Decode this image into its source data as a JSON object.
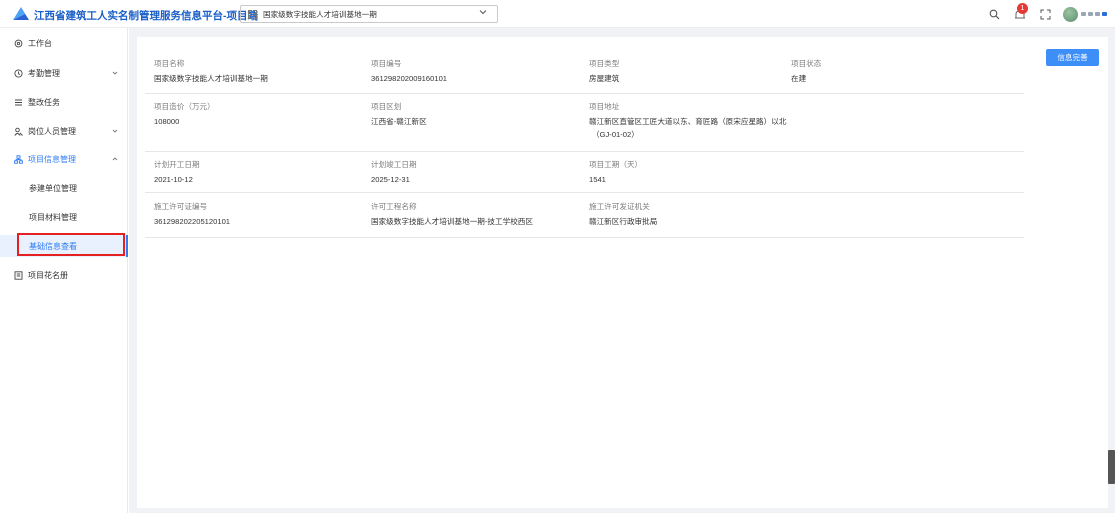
{
  "header": {
    "title": "江西省建筑工人实名制管理服务信息平台-项目端",
    "project_select": "国家级数字技能人才培训基地一期",
    "notification_count": "1"
  },
  "sidebar": {
    "items": [
      {
        "label": "工作台",
        "icon": "gear-icon"
      },
      {
        "label": "考勤管理",
        "icon": "clock-icon"
      },
      {
        "label": "整改任务",
        "icon": "list-icon"
      },
      {
        "label": "岗位人员管理",
        "icon": "person-icon"
      },
      {
        "label": "项目信息管理",
        "icon": "org-icon"
      },
      {
        "label": "参建单位管理"
      },
      {
        "label": "项目材料管理"
      },
      {
        "label": "基础信息查看"
      },
      {
        "label": "项目花名册",
        "icon": "roster-icon"
      }
    ]
  },
  "main": {
    "complete_button": "信息完善",
    "fields": [
      {
        "label": "项目名称",
        "value": "国家级数字技能人才培训基地一期"
      },
      {
        "label": "项目编号",
        "value": "361298202009160101"
      },
      {
        "label": "项目类型",
        "value": "房屋建筑"
      },
      {
        "label": "项目状态",
        "value": "在建"
      },
      {
        "label": "项目造价（万元）",
        "value": "108000"
      },
      {
        "label": "项目区划",
        "value": "江西省-赣江新区"
      },
      {
        "label": "项目地址",
        "value": "赣江新区直管区工匠大道以东、育匠路（原宋应星路）以北",
        "value2": "（GJ-01-02）"
      },
      {
        "label": "计划开工日期",
        "value": "2021-10-12"
      },
      {
        "label": "计划竣工日期",
        "value": "2025-12-31"
      },
      {
        "label": "项目工期（天）",
        "value": "1541"
      },
      {
        "label": "施工许可证编号",
        "value": "361298202205120101"
      },
      {
        "label": "许可工程名称",
        "value": "国家级数字技能人才培训基地一期-技工学校西区"
      },
      {
        "label": "施工许可发证机关",
        "value": "赣江新区行政审批局"
      }
    ]
  },
  "colors": {
    "accent": "#2e7cf6",
    "title": "#1a5ec8",
    "highlight_box": "#e42020",
    "badge": "#e53935"
  }
}
